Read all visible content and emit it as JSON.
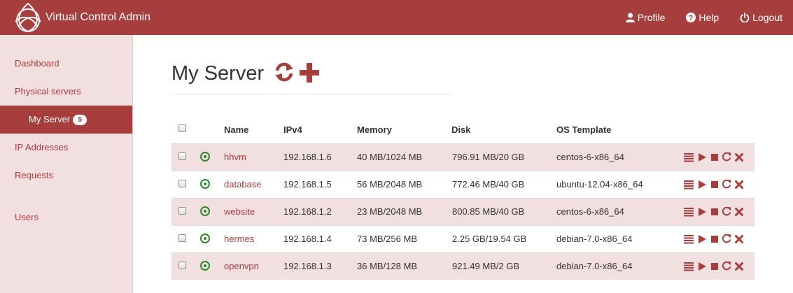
{
  "app": {
    "title": "Virtual Control Admin",
    "brand_color": "#a73e3e",
    "sidebar_bg": "#f2dfe0",
    "status_color": "#2a8a2a"
  },
  "nav": {
    "profile": "Profile",
    "help": "Help",
    "logout": "Logout"
  },
  "sidebar": {
    "items": [
      {
        "label": "Dashboard"
      },
      {
        "label": "Physical servers"
      },
      {
        "label": "My Server",
        "badge": "5",
        "active": true
      },
      {
        "label": "IP Addresses"
      },
      {
        "label": "Requests"
      },
      {
        "label": "Users"
      }
    ]
  },
  "page": {
    "title": "My Server",
    "refresh_icon": "refresh-icon",
    "add_icon": "plus-icon"
  },
  "table": {
    "columns": [
      "Name",
      "IPv4",
      "Memory",
      "Disk",
      "OS Template"
    ],
    "rows": [
      {
        "status": "running",
        "name": "hhvm",
        "ipv4": "192.168.1.6",
        "memory": "40 MB/1024 MB",
        "disk": "796.91 MB/20 GB",
        "os": "centos-6-x86_64"
      },
      {
        "status": "running",
        "name": "database",
        "ipv4": "192.168.1.5",
        "memory": "56 MB/2048 MB",
        "disk": "772.46 MB/40 GB",
        "os": "ubuntu-12.04-x86_64"
      },
      {
        "status": "running",
        "name": "website",
        "ipv4": "192.168.1.2",
        "memory": "23 MB/2048 MB",
        "disk": "800.85 MB/40 GB",
        "os": "centos-6-x86_64"
      },
      {
        "status": "running",
        "name": "hermes",
        "ipv4": "192.168.1.4",
        "memory": "73 MB/256 MB",
        "disk": "2.25 GB/19.54 GB",
        "os": "debian-7.0-x86_64"
      },
      {
        "status": "running",
        "name": "openvpn",
        "ipv4": "192.168.1.3",
        "memory": "36 MB/128 MB",
        "disk": "921.49 MB/2 GB",
        "os": "debian-7.0-x86_64"
      }
    ],
    "row_actions": [
      "list-icon",
      "play-icon",
      "stop-icon",
      "restart-icon",
      "delete-icon"
    ]
  }
}
